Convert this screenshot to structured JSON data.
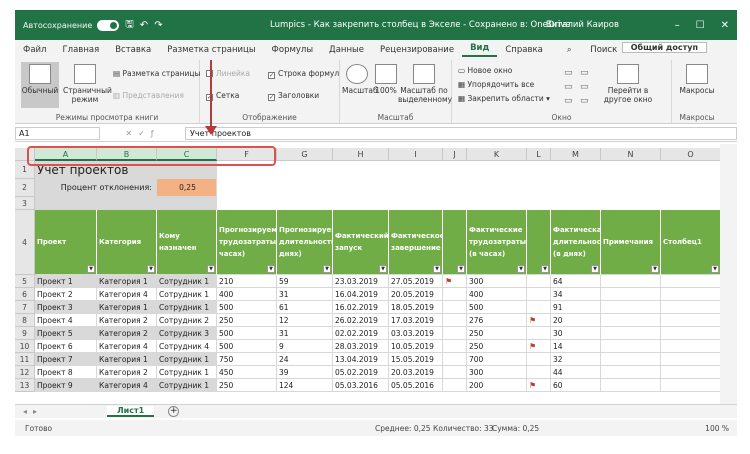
{
  "titlebar": {
    "autosave": "Автосохранение",
    "title": "Lumpics - Как закрепить столбец в Экселе - Сохранено в: OneDrive",
    "user": "Виталий Каиров"
  },
  "menu": {
    "items": [
      "Файл",
      "Главная",
      "Вставка",
      "Разметка страницы",
      "Формулы",
      "Данные",
      "Рецензирование",
      "Вид",
      "Справка",
      "Поиск"
    ],
    "active": "Вид",
    "share": "Общий доступ"
  },
  "ribbon": {
    "normal": "Обычный",
    "page_mode": "Страничный режим",
    "page_layout": "Разметка страницы",
    "views": "Представления",
    "group1": "Режимы просмотра книги",
    "ruler": "Линейка",
    "formula_bar": "Строка формул",
    "grid": "Сетка",
    "headings": "Заголовки",
    "group2": "Отображение",
    "zoom": "Масштаб",
    "zoom100": "100%",
    "zoom_sel": "Масштаб по выделенному",
    "group3": "Масштаб",
    "new_window": "Новое окно",
    "arrange_all": "Упорядочить все",
    "freeze": "Закрепить области",
    "switch": "Перейти в другое окно",
    "group4": "Окно",
    "macros": "Макросы",
    "group5": "Макросы"
  },
  "formula": {
    "namebox": "A1",
    "value": "Учет проектов"
  },
  "columns": [
    "A",
    "B",
    "C",
    "F",
    "G",
    "H",
    "I",
    "J",
    "K",
    "L",
    "M",
    "N",
    "O"
  ],
  "rows": [
    "1",
    "2",
    "3",
    "4",
    "5",
    "6",
    "7",
    "8",
    "9",
    "10",
    "11",
    "12",
    "13"
  ],
  "sheet": {
    "title": "Учет проектов",
    "deviation_label": "Процент отклонения:",
    "deviation_value": "0,25",
    "headers": [
      "Проект",
      "Категория",
      "Кому назначен",
      "Прогнозируемые трудозатраты (в часах)",
      "Прогнозируемая длительность (в днях)",
      "Фактический запуск",
      "Фактическое завершение",
      "",
      "Фактические трудозатраты (в часах)",
      "",
      "Фактическая длительность (в днях)",
      "Примечания",
      "Столбец1"
    ],
    "data": [
      [
        "Проект 1",
        "Категория 1",
        "Сотрудник 1",
        "210",
        "59",
        "23.03.2019",
        "27.05.2019",
        "flag",
        "300",
        "",
        "64"
      ],
      [
        "Проект 2",
        "Категория 4",
        "Сотрудник 1",
        "400",
        "31",
        "16.04.2019",
        "20.05.2019",
        "",
        "400",
        "",
        "34"
      ],
      [
        "Проект 3",
        "Категория 1",
        "Сотрудник 1",
        "500",
        "61",
        "16.02.2019",
        "18.05.2019",
        "",
        "500",
        "",
        "91"
      ],
      [
        "Проект 4",
        "Категория 2",
        "Сотрудник 2",
        "250",
        "12",
        "26.02.2019",
        "17.03.2019",
        "",
        "276",
        "flag",
        "20"
      ],
      [
        "Проект 5",
        "Категория 2",
        "Сотрудник 3",
        "500",
        "31",
        "02.02.2019",
        "03.03.2019",
        "",
        "250",
        "",
        "30"
      ],
      [
        "Проект 6",
        "Категория 4",
        "Сотрудник 4",
        "500",
        "9",
        "28.03.2019",
        "10.05.2019",
        "",
        "250",
        "flag",
        "14"
      ],
      [
        "Проект 7",
        "Категория 1",
        "Сотрудник 1",
        "750",
        "24",
        "13.04.2019",
        "15.05.2019",
        "",
        "700",
        "",
        "32"
      ],
      [
        "Проект 8",
        "Категория 2",
        "Сотрудник 1",
        "450",
        "39",
        "05.02.2019",
        "20.03.2019",
        "",
        "300",
        "",
        "44"
      ],
      [
        "Проект 9",
        "Категория 4",
        "Сотрудник 1",
        "250",
        "124",
        "05.03.2016",
        "05.05.2016",
        "",
        "200",
        "flag",
        "60"
      ]
    ]
  },
  "sheetbar": {
    "tab": "Лист1",
    "add": "+"
  },
  "status": {
    "ready": "Готово",
    "avg": "Среднее: 0,25",
    "count": "Количество: 33",
    "sum": "Сумма: 0,25",
    "zoom": "100 %"
  }
}
